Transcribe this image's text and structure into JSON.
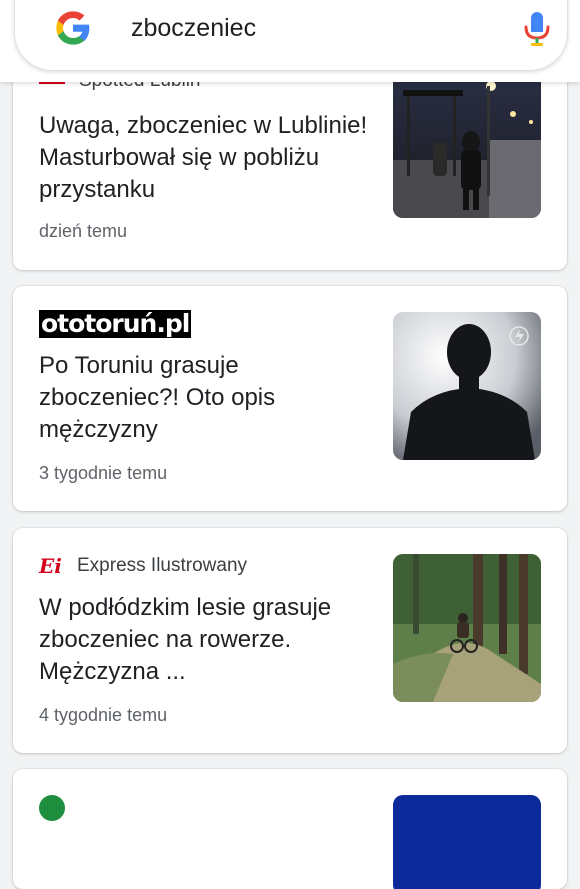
{
  "search": {
    "query": "zboczeniec",
    "logo_icon": "google-g-icon",
    "mic_icon": "microphone-icon"
  },
  "cards": [
    {
      "source": "Spotted Lublin",
      "headline": "Uwaga, zboczeniec w Lublinie! Masturbował się w pobliżu przystanku",
      "time": "dzień temu",
      "thumbnail": "night-bus-stop-photo"
    },
    {
      "source": "ototoruń.pl",
      "headline": "Po Toruniu grasuje zboczeniec?! Oto opis mężczyzny",
      "time": "3 tygodnie temu",
      "thumbnail": "silhouette-photo"
    },
    {
      "source": "Express Ilustrowany",
      "source_logo": "Ei",
      "headline": "W podłódzkim lesie grasuje zboczeniec na rowerze. Mężczyzna ...",
      "time": "4 tygodnie temu",
      "thumbnail": "forest-cyclist-photo"
    }
  ],
  "colors": {
    "background": "#f1f3f4",
    "headline": "#202124",
    "meta": "#5f6368",
    "ei_red": "#d6001c"
  }
}
